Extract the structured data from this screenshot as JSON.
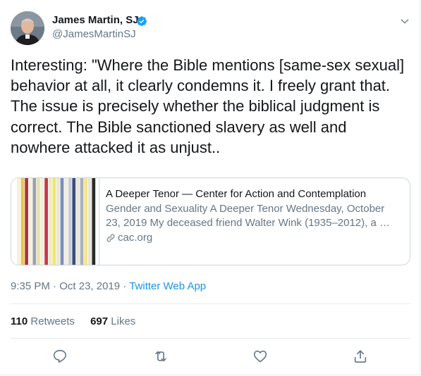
{
  "author": {
    "name": "James Martin, SJ",
    "handle": "@JamesMartinSJ",
    "verified": true
  },
  "tweet": {
    "text": "Interesting: \"Where the Bible mentions [same-sex sexual] behavior at all, it clearly condemns it. I freely grant that. The issue is precisely whether the biblical judgment is correct. The Bible sanctioned slavery as well and nowhere attacked it as unjust.."
  },
  "card": {
    "title": "A Deeper Tenor — Center for Action and Contemplation",
    "description": "Gender and Sexuality A Deeper Tenor Wednesday, October 23, 2019 My deceased friend Walter Wink (1935–2012), a …",
    "domain": "cac.org",
    "stripe_colors": [
      "#f5f0dc",
      "#e8c94a",
      "#b0323a",
      "#f3f0de",
      "#9a9fb0",
      "#e6e3a0",
      "#f2eddc",
      "#c23b4c",
      "#efe9c8",
      "#f0e66a",
      "#e9e6da",
      "#7b8fb5",
      "#f1ede0",
      "#c9ced6",
      "#3b4e7a",
      "#eae6da",
      "#a8b0c0",
      "#f3e78a",
      "#e8e4d8",
      "#2a2a2a"
    ]
  },
  "meta": {
    "time": "9:35 PM",
    "dot1": "·",
    "date": "Oct 23, 2019",
    "dot2": "·",
    "app": "Twitter Web App"
  },
  "stats": {
    "retweets_count": "110",
    "retweets_label": "Retweets",
    "likes_count": "697",
    "likes_label": "Likes"
  },
  "actions": {
    "icons": [
      "reply-icon",
      "retweet-icon",
      "like-icon",
      "share-icon"
    ]
  },
  "colors": {
    "accent": "#1da1f2",
    "link": "#1b95e0",
    "secondary_text": "#657786",
    "primary_text": "#14171a",
    "border": "#e6ecf0"
  }
}
